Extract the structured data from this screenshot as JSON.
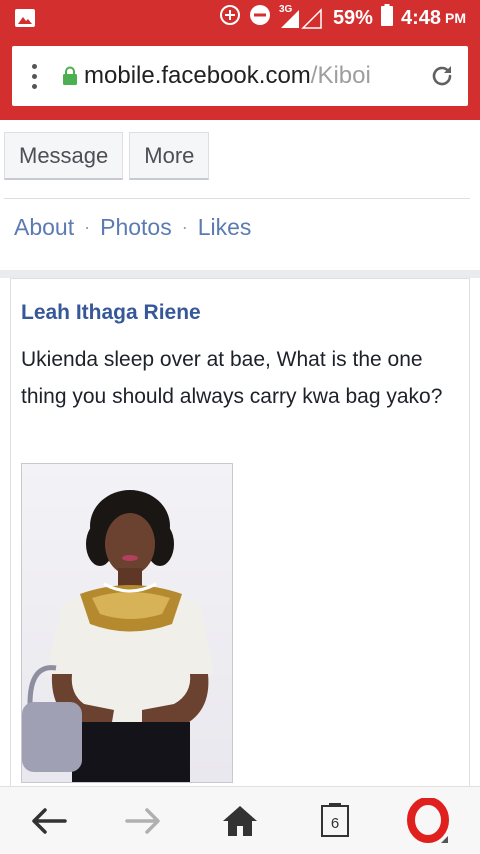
{
  "status_bar": {
    "network": "3G",
    "battery": "59%",
    "time": "4:48",
    "ampm": "PM"
  },
  "browser": {
    "url_main": "mobile.facebook.com",
    "url_rest": "/Kiboi",
    "tab_count": "6"
  },
  "profile_actions": {
    "message": "Message",
    "more": "More"
  },
  "profile_links": {
    "about": "About",
    "separator": "·",
    "photos": "Photos",
    "likes": "Likes"
  },
  "post": {
    "author": "Leah Ithaga Riene",
    "text": "Ukienda sleep over at bae, What is the one thing you should always carry kwa bag yako?"
  },
  "icons": [
    "gallery-icon",
    "add-circle-icon",
    "dnd-icon",
    "signal-icon",
    "battery-icon",
    "lock-icon",
    "reload-icon",
    "back-icon",
    "forward-icon",
    "home-icon",
    "tabs-icon",
    "opera-icon"
  ],
  "colors": {
    "browser_accent": "#d32f2f",
    "fb_link": "#365899",
    "fb_nav_link": "#5b7bb2"
  }
}
